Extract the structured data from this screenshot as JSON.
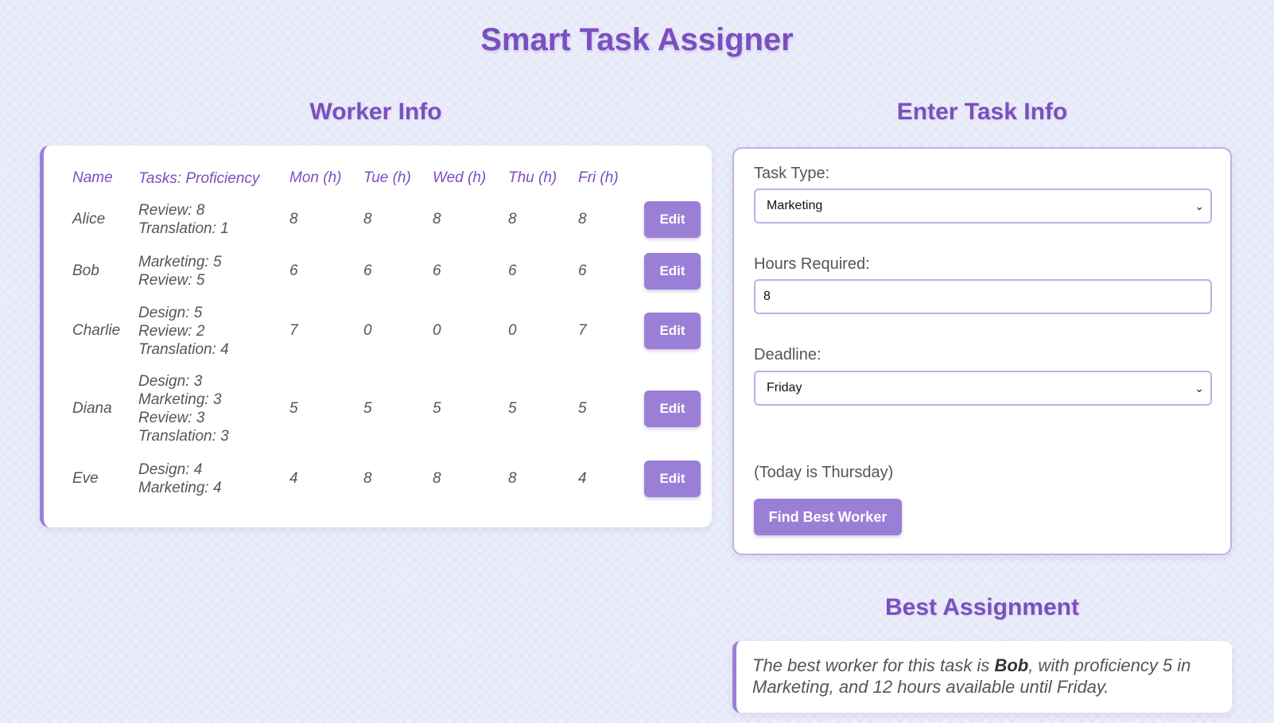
{
  "app": {
    "title": "Smart Task Assigner"
  },
  "worker_section": {
    "title": "Worker Info",
    "columns": [
      "Name",
      "Tasks: Proficiency",
      "Mon (h)",
      "Tue (h)",
      "Wed (h)",
      "Thu (h)",
      "Fri (h)"
    ],
    "edit_label": "Edit",
    "workers": [
      {
        "name": "Alice",
        "tasks": [
          "Review: 8",
          "Translation: 1"
        ],
        "hours": [
          "8",
          "8",
          "8",
          "8",
          "8"
        ]
      },
      {
        "name": "Bob",
        "tasks": [
          "Marketing: 5",
          "Review: 5"
        ],
        "hours": [
          "6",
          "6",
          "6",
          "6",
          "6"
        ]
      },
      {
        "name": "Charlie",
        "tasks": [
          "Design: 5",
          "Review: 2",
          "Translation: 4"
        ],
        "hours": [
          "7",
          "0",
          "0",
          "0",
          "7"
        ]
      },
      {
        "name": "Diana",
        "tasks": [
          "Design: 3",
          "Marketing: 3",
          "Review: 3",
          "Translation: 3"
        ],
        "hours": [
          "5",
          "5",
          "5",
          "5",
          "5"
        ]
      },
      {
        "name": "Eve",
        "tasks": [
          "Design: 4",
          "Marketing: 4"
        ],
        "hours": [
          "4",
          "8",
          "8",
          "8",
          "4"
        ]
      }
    ]
  },
  "task_section": {
    "title": "Enter Task Info",
    "task_type_label": "Task Type:",
    "task_type_value": "Marketing",
    "hours_label": "Hours Required:",
    "hours_value": "8",
    "deadline_label": "Deadline:",
    "deadline_value": "Friday",
    "today_note": "(Today is Thursday)",
    "find_button": "Find Best Worker"
  },
  "result_section": {
    "title": "Best Assignment",
    "text_before": "The best worker for this task is ",
    "worker": "Bob",
    "text_after": ", with proficiency 5 in Marketing, and 12 hours available until Friday."
  },
  "colors": {
    "accent": "#7b4fc0",
    "button": "#9b7fd6",
    "border": "#c2aee8"
  }
}
